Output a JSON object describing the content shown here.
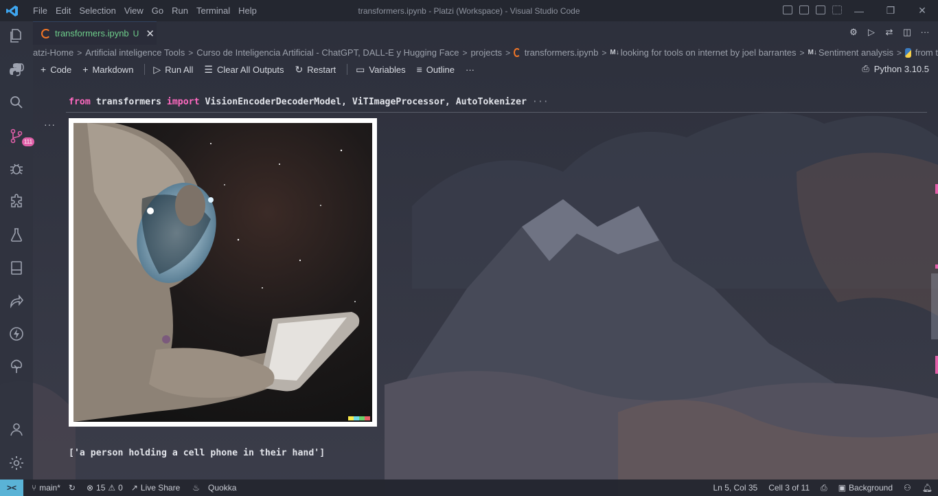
{
  "window": {
    "title": "transformers.ipynb - Platzi (Workspace) - Visual Studio Code",
    "menu": [
      "File",
      "Edit",
      "Selection",
      "View",
      "Go",
      "Run",
      "Terminal",
      "Help"
    ],
    "controls": {
      "minimize": "—",
      "restore": "❐",
      "close": "✕"
    }
  },
  "activity_bar": {
    "items": [
      "explorer-icon",
      "python-icon",
      "search-icon",
      "source-control-icon",
      "debug-icon",
      "extensions-icon",
      "testing-icon",
      "notebook-icon",
      "live-share-icon",
      "lightning-icon",
      "tree-icon",
      "account-icon",
      "settings-gear-icon"
    ],
    "scm_badge": "111"
  },
  "tab": {
    "label": "transformers.ipynb",
    "status": "U",
    "close": "✕"
  },
  "breadcrumb": {
    "items": [
      "atzi-Home",
      "Artificial inteligence Tools",
      "Curso de Inteligencia Artificial - ChatGPT, DALL-E y Hugging Face",
      "projects",
      "transformers.ipynb",
      "looking for tools on internet by joel barrantes",
      "Sentiment analysis",
      "from t"
    ],
    "md_marker": "M↓"
  },
  "notebook_toolbar": {
    "code": "Code",
    "markdown": "Markdown",
    "run_all": "Run All",
    "clear_all_outputs": "Clear All Outputs",
    "restart": "Restart",
    "variables": "Variables",
    "outline": "Outline",
    "more": "···",
    "kernel": "Python 3.10.5"
  },
  "cell": {
    "kw_from": "from",
    "module": " transformers ",
    "kw_import": "import",
    "names": " VisionEncoderDecoderModel, ViTImageProcessor, AutoTokenizer",
    "fold": " ···",
    "output_menu": "···",
    "output_text": "['a person holding a cell phone in their hand']"
  },
  "statusbar": {
    "remote": "><",
    "branch": "main*",
    "errors": "15",
    "warnings": "0",
    "live_share": "Live Share",
    "quokka": "Quokka",
    "position": "Ln 5, Col 35",
    "cell_info": "Cell 3 of 11",
    "background": "Background"
  },
  "colors": {
    "accent_green": "#6fd08c",
    "keyword_pink": "#ff6ac1",
    "badge_pink": "#e05fa8",
    "remote_blue": "#5ab3d6",
    "jupyter_orange": "#f37626"
  }
}
